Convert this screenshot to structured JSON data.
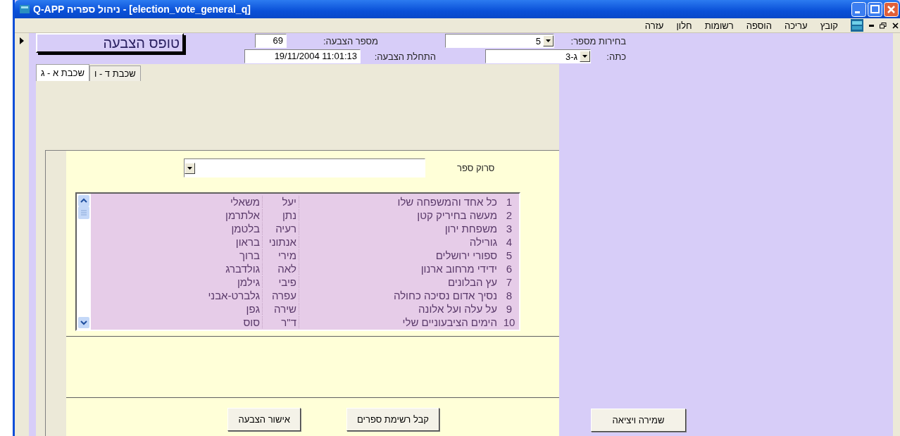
{
  "window": {
    "title": "Q-APP ניהול ספריה - [election_vote_general_q]"
  },
  "menu": [
    "קובץ",
    "עריכה",
    "הוספה",
    "רשומות",
    "חלון",
    "עזרה"
  ],
  "form": {
    "title_button": "טופס הצבעה",
    "fields": [
      {
        "label": "בחירות מספר:",
        "value": "5",
        "kind": "combo"
      },
      {
        "label": "מספר הצבעה:",
        "value": "69",
        "kind": "text"
      },
      {
        "label": "כתה:",
        "value": "ג-3",
        "kind": "combo"
      },
      {
        "label": "התחלת הצבעה:",
        "value": "19/11/2004 11:01:13",
        "kind": "text"
      }
    ]
  },
  "tabs": [
    {
      "label": "שכבת ד - ו",
      "selected": false
    },
    {
      "label": "שכבת א - ג",
      "selected": true
    }
  ],
  "scan": {
    "label": "סרוק ספר"
  },
  "books": [
    {
      "number": "1",
      "title": "כל אחד והמשפחה שלו",
      "first_name": "יעל",
      "last_name": "משאלי"
    },
    {
      "number": "2",
      "title": "מעשה בחיריק קטן",
      "first_name": "נתן",
      "last_name": "אלתרמן"
    },
    {
      "number": "3",
      "title": "משפחת ירון",
      "first_name": "רעיה",
      "last_name": "בלטמן"
    },
    {
      "number": "4",
      "title": "גורילה",
      "first_name": "אנתוני",
      "last_name": "בראון"
    },
    {
      "number": "5",
      "title": "ספורי ירושלים",
      "first_name": "מירי",
      "last_name": "ברוך"
    },
    {
      "number": "6",
      "title": "ידידי מרחוב ארנון",
      "first_name": "לאה",
      "last_name": "גולדברג"
    },
    {
      "number": "7",
      "title": "עץ הבלונים",
      "first_name": "פיבי",
      "last_name": "גילמן"
    },
    {
      "number": "8",
      "title": "נסיך אדום נסיכה כחולה",
      "first_name": "עפרה",
      "last_name": "גלברט-אבני"
    },
    {
      "number": "9",
      "title": "על עלה ועל אלונה",
      "first_name": "שירה",
      "last_name": "גפן"
    },
    {
      "number": "10",
      "title": "הימים הציבעוניים שלי",
      "first_name": "ד\"ר",
      "last_name": "סוס"
    }
  ],
  "buttons": [
    "קבל רשימת ספרים",
    "אישור הצבעה"
  ],
  "save_button": "שמירה ויציאה"
}
